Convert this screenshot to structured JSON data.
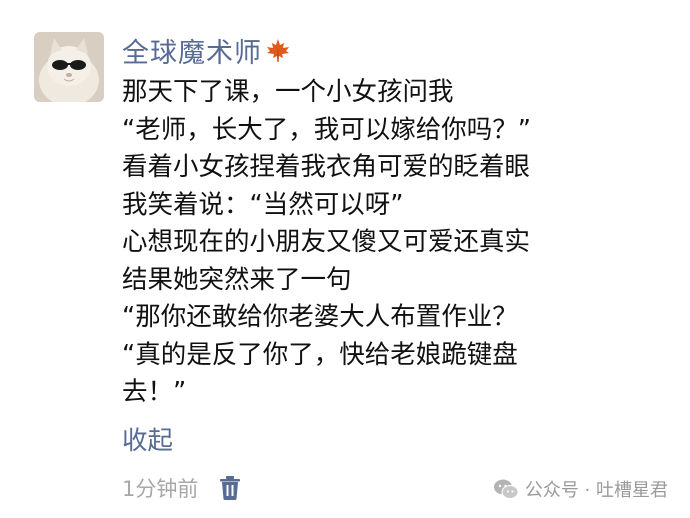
{
  "post": {
    "username": "全球魔术师",
    "username_icon": "maple-leaf-icon",
    "lines": [
      "那天下了课，一个小女孩问我",
      "“老师，长大了，我可以嫁给你吗？”",
      "看着小女孩捏着我衣角可爱的眨着眼",
      "我笑着说：“当然可以呀”",
      "心想现在的小朋友又傻又可爱还真实",
      "结果她突然来了一句",
      "“那你还敢给你老婆大人布置作业？",
      "“真的是反了你了，快给老娘跪键盘",
      "去！”"
    ],
    "collapse_label": "收起",
    "timestamp": "1分钟前",
    "delete_icon": "trash-icon"
  },
  "watermark": {
    "icon": "wechat-icon",
    "text": "公众号 · 吐槽星君"
  },
  "colors": {
    "link": "#576b95",
    "text": "#111111",
    "meta": "#a8a8a8",
    "maple": "#e05a1c"
  }
}
